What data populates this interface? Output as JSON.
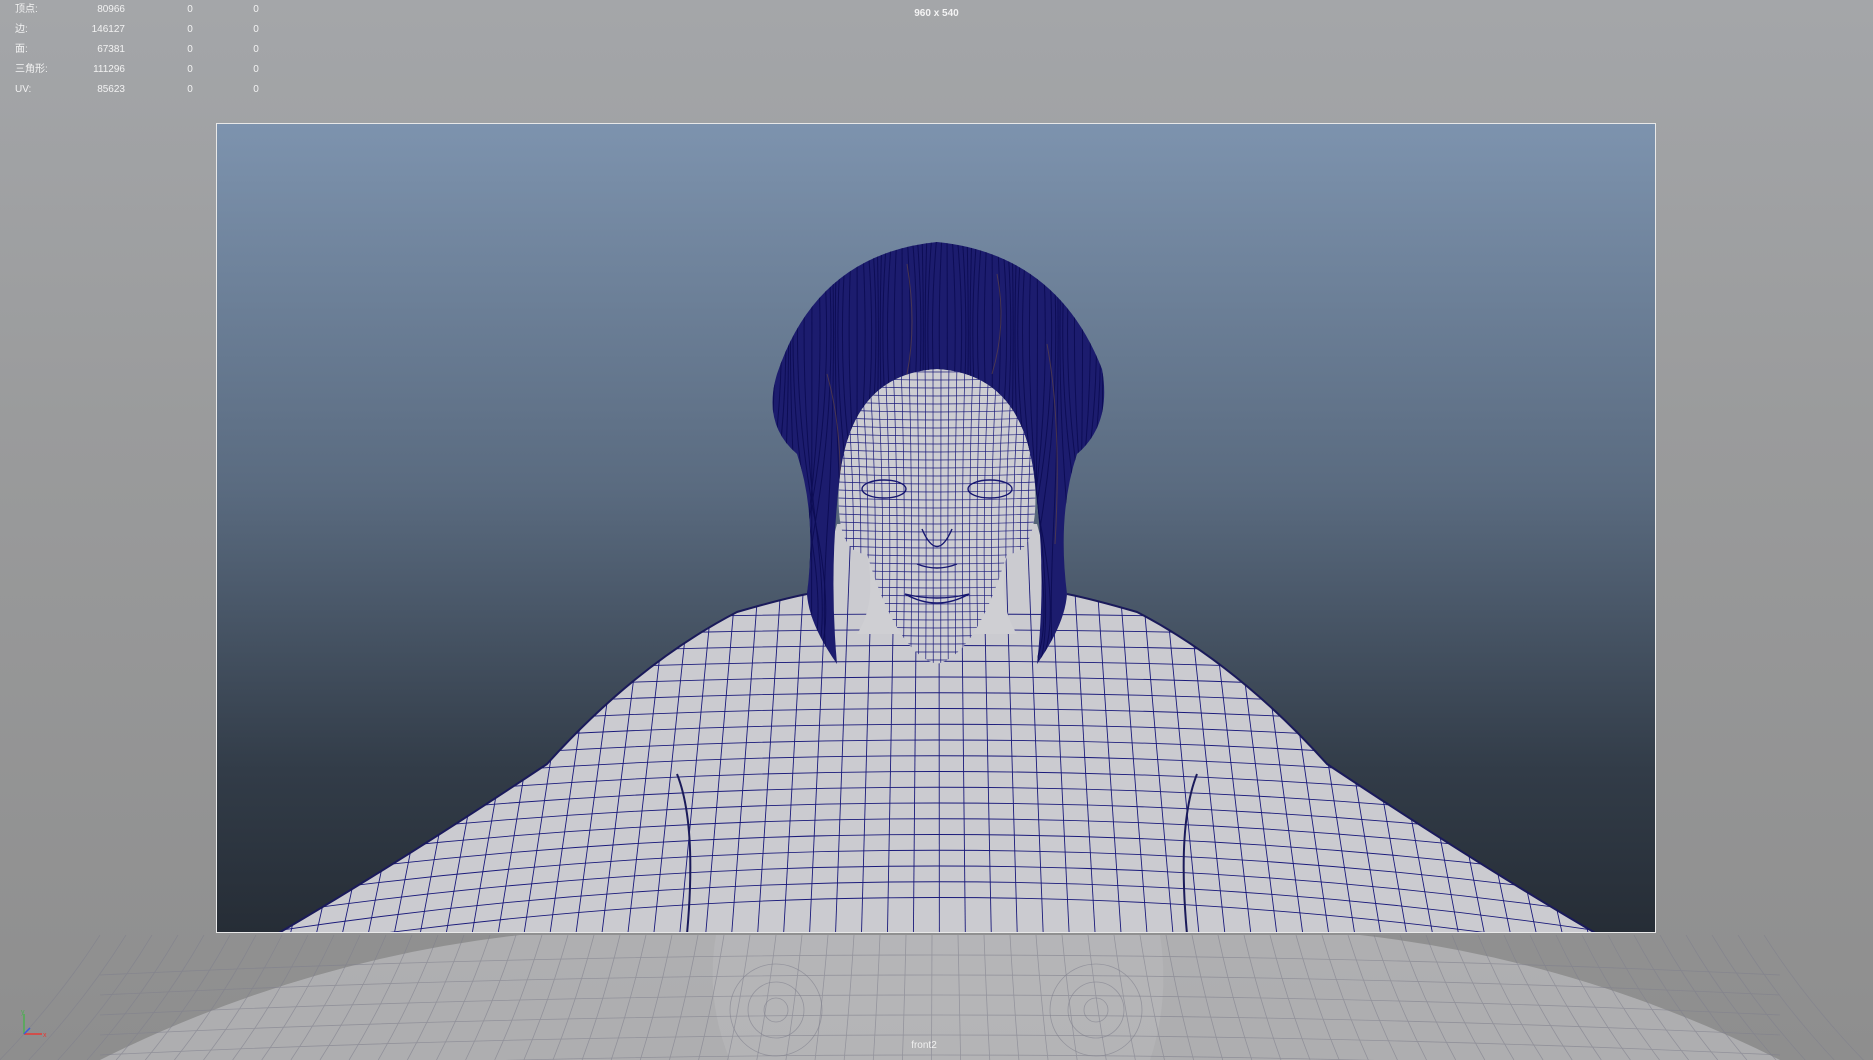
{
  "hud": {
    "rows": [
      {
        "label": "顶点:",
        "v1": "80966",
        "v2": "0",
        "v3": "0"
      },
      {
        "label": "边:",
        "v1": "146127",
        "v2": "0",
        "v3": "0"
      },
      {
        "label": "面:",
        "v1": "67381",
        "v2": "0",
        "v3": "0"
      },
      {
        "label": "三角形:",
        "v1": "111296",
        "v2": "0",
        "v3": "0"
      },
      {
        "label": "UV:",
        "v1": "85623",
        "v2": "0",
        "v3": "0"
      }
    ]
  },
  "viewport": {
    "resolution": "960 x 540",
    "camera": "front2"
  },
  "colors": {
    "wireframe": "#1a1a7a",
    "skin": "#cfcfd3",
    "hair": "#16167a"
  },
  "icons": [
    "view-axis-icon"
  ]
}
